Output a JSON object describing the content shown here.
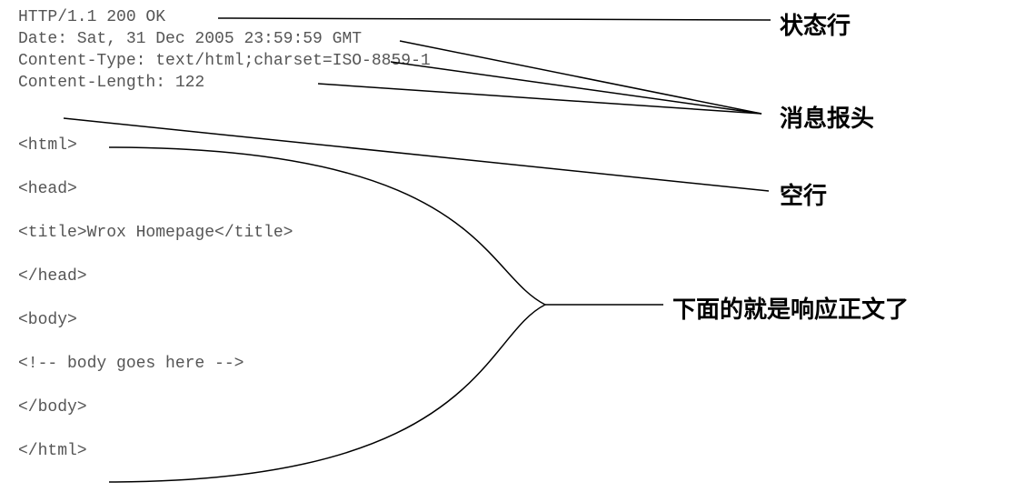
{
  "response": {
    "status_line": "HTTP/1.1 200 OK",
    "headers": {
      "date": "Date: Sat, 31 Dec 2005 23:59:59 GMT",
      "content_type": "Content-Type: text/html;charset=ISO-8859-1",
      "content_length": "Content-Length: 122"
    },
    "body_lines": {
      "l1": "<html>",
      "l2": "<head>",
      "l3": "<title>Wrox Homepage</title>",
      "l4": "</head>",
      "l5": "<body>",
      "l6": "<!-- body goes here -->",
      "l7": "</body>",
      "l8": "</html>"
    }
  },
  "labels": {
    "status_line": "状态行",
    "headers": "消息报头",
    "blank_line": "空行",
    "body": "下面的就是响应正文了"
  }
}
